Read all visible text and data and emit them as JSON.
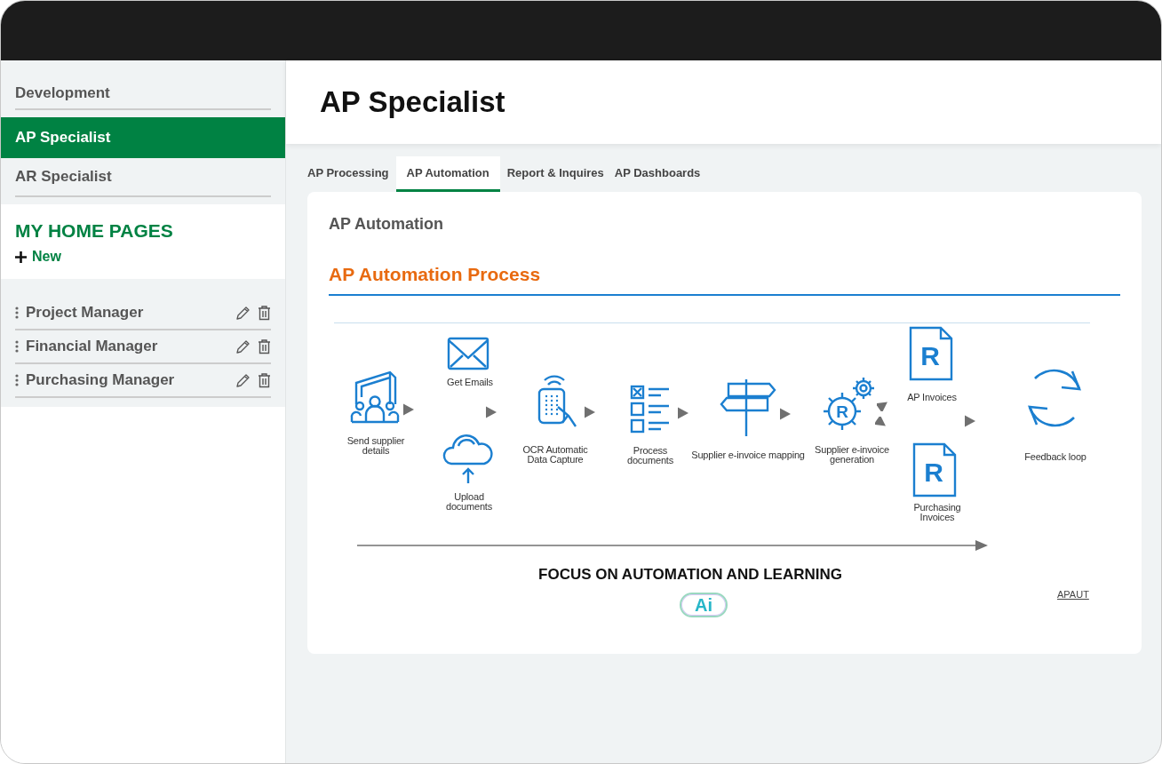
{
  "sidebar": {
    "items": [
      {
        "label": "Development",
        "selected": false
      },
      {
        "label": "AP Specialist",
        "selected": true
      },
      {
        "label": "AR Specialist",
        "selected": false
      }
    ],
    "home_pages": {
      "heading": "MY HOME PAGES",
      "new_button": "New",
      "items": [
        {
          "label": "Project Manager"
        },
        {
          "label": "Financial Manager"
        },
        {
          "label": "Purchasing Manager"
        }
      ]
    }
  },
  "page": {
    "title": "AP Specialist"
  },
  "tabs": [
    {
      "label": "AP Processing",
      "selected": false
    },
    {
      "label": "AP Automation",
      "selected": true
    },
    {
      "label": "Report & Inquires",
      "selected": false
    },
    {
      "label": "AP Dashboards",
      "selected": false
    }
  ],
  "card": {
    "title": "AP Automation",
    "section_title": "AP Automation Process",
    "diagram": {
      "steps": [
        {
          "kind": "people",
          "label": "Send supplier details"
        },
        {
          "kind": "mail",
          "label": "Get Emails"
        },
        {
          "kind": "cloud",
          "label": "Upload documents"
        },
        {
          "kind": "scan",
          "label": "OCR Automatic Data Capture"
        },
        {
          "kind": "checklist",
          "label": "Process documents"
        },
        {
          "kind": "signpost",
          "label": "Supplier e-invoice mapping"
        },
        {
          "kind": "gears",
          "label": "Supplier e-invoice generation"
        },
        {
          "kind": "document",
          "label": "AP Invoices",
          "letter": "R"
        },
        {
          "kind": "document",
          "label": "Purchasing Invoices",
          "letter": "R"
        },
        {
          "kind": "cycle",
          "label": "Feedback loop"
        }
      ],
      "gear_letter": "R",
      "caption": "FOCUS ON AUTOMATION AND LEARNING",
      "badge": "Ai",
      "link": "APAUT"
    }
  }
}
